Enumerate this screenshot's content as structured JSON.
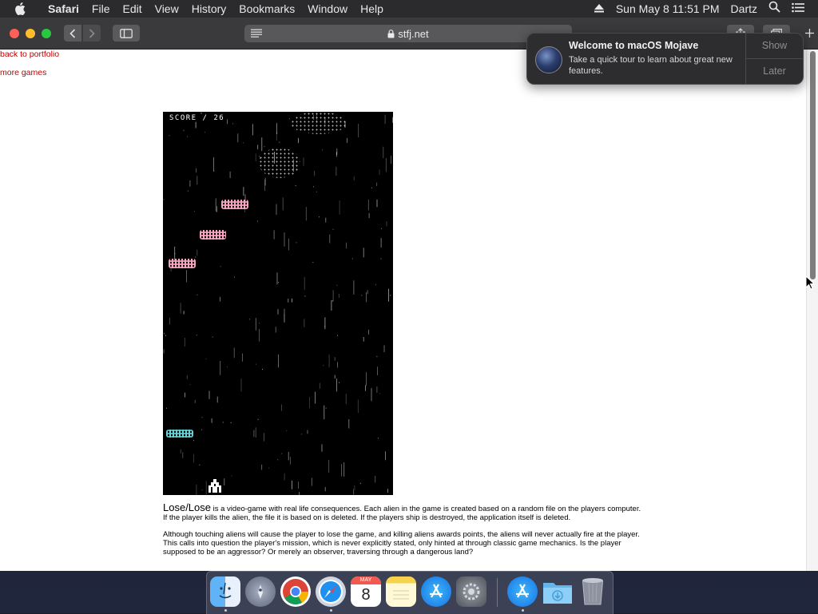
{
  "menubar": {
    "app": "Safari",
    "menus": [
      "File",
      "Edit",
      "View",
      "History",
      "Bookmarks",
      "Window",
      "Help"
    ],
    "clock": "Sun May 8  11:51 PM",
    "user": "Dartz"
  },
  "browser": {
    "address": "stfj.net"
  },
  "page": {
    "back_link": "back to portfolio",
    "more_link": "more games",
    "score": "SCORE / 26",
    "game_title": "Lose/Lose",
    "para1": " is a video-game with real life consequences. Each alien in the game is created based on a random file on the players computer. If the player kills the alien, the file it is based on is deleted. If the players ship is destroyed, the application itself is deleted.",
    "para2": "Although touching aliens will cause the player to lose the game, and killing aliens awards points, the aliens will never actually fire at the player. This calls into question the player's mission, which is never explicitly stated, only hinted at through classic game mechanics. Is the player supposed to be an aggressor? Or merely an observer, traversing through a dangerous land?"
  },
  "notification": {
    "title": "Welcome to macOS Mojave",
    "body": "Take a quick tour to learn about great new features.",
    "show": "Show",
    "later": "Later"
  },
  "dock": {
    "items": [
      "finder-icon",
      "launchpad-icon",
      "chrome-icon",
      "safari-icon",
      "calendar-icon",
      "notes-icon",
      "app-store-icon",
      "system-preferences-icon",
      "app-store-download-icon",
      "downloads-folder-icon",
      "trash-icon"
    ],
    "calendar_month": "MAY",
    "calendar_day": "8"
  },
  "colors": {
    "link": "#c00000",
    "alien_pink": "#f4a7c0",
    "alien_cyan": "#6ccfd3"
  }
}
